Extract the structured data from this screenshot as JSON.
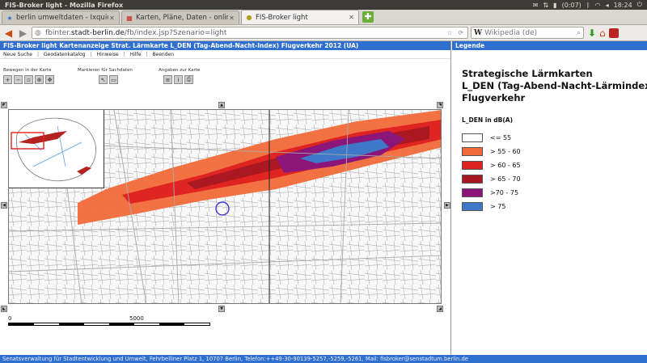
{
  "window": {
    "title": "FIS-Broker light - Mozilla Firefox",
    "tray": {
      "battery": "(0:07)",
      "clock": "18:24"
    }
  },
  "tabs": [
    {
      "label": "berlin umweltdaten - Ixquic...",
      "active": false
    },
    {
      "label": "Karten, Pläne, Daten - onlin...",
      "active": false
    },
    {
      "label": "FIS-Broker light",
      "active": true
    }
  ],
  "nav": {
    "url_prefix": "fbinter.",
    "url_host": "stadt-berlin.de",
    "url_path": "/fb/index.jsp?Szenario=light",
    "search_engine": "W",
    "search_placeholder": "Wikipedia (de)"
  },
  "page": {
    "header": "FIS-Broker light Kartenanzeige Strat. Lärmkarte L_DEN (Tag-Abend-Nacht-Index) Flugverkehr 2012 (UA)",
    "menu": [
      "Neue Suche",
      "Geodatenkatalog",
      "Hinweise",
      "Hilfe",
      "Beenden"
    ],
    "tool_groups": [
      {
        "label": "Bewegen in der Karte",
        "icons": [
          "zoom-in",
          "zoom-out",
          "zoom-box",
          "zoom-full",
          "pan"
        ]
      },
      {
        "label": "Markieren für Sachdaten",
        "icons": [
          "select-point",
          "select-rect"
        ]
      },
      {
        "label": "Angaben zur Karte",
        "icons": [
          "info",
          "legend",
          "print"
        ]
      }
    ],
    "scale": {
      "start": "0",
      "mid": "5000"
    }
  },
  "legend": {
    "header": "Legende",
    "title_lines": [
      "Strategische Lärmkarten",
      "L_DEN (Tag-Abend-Nacht-Lärmindex)",
      "Flugverkehr"
    ],
    "subtitle": "L_DEN in dB(A)",
    "items": [
      {
        "label": "<= 55",
        "color": "#ffffff"
      },
      {
        "label": "> 55 - 60",
        "color": "#f26a3a"
      },
      {
        "label": "> 60 - 65",
        "color": "#dd2020"
      },
      {
        "label": "> 65 - 70",
        "color": "#a81822"
      },
      {
        "label": ">70 - 75",
        "color": "#8c157a"
      },
      {
        "label": "> 75",
        "color": "#3f78c8"
      }
    ]
  },
  "footer": "Senatsverwaltung für Stadtentwicklung und Umwelt, Fehrbelliner Platz 1, 10707 Berlin, Telefon:++49-30-90139-5257,-5259,-5261, Mail: fisbroker@senstadtum.berlin.de",
  "colors": {
    "accent": "#2f6fd0"
  }
}
